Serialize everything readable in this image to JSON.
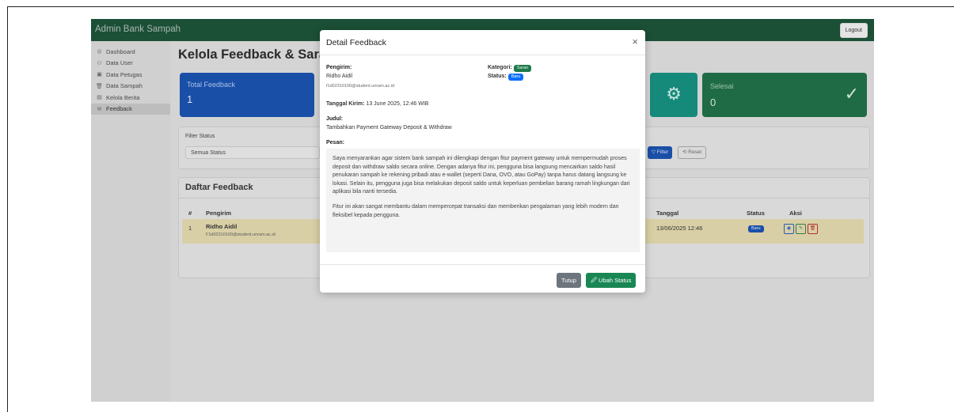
{
  "navbar": {
    "brand": "Admin Bank Sampah",
    "logout": "Logout"
  },
  "sidebar": {
    "items": [
      {
        "icon": "dashboard-icon",
        "glyph": "◎",
        "label": "Dashboard"
      },
      {
        "icon": "users-icon",
        "glyph": "⚇",
        "label": "Data User"
      },
      {
        "icon": "officer-icon",
        "glyph": "▣",
        "label": "Data Petugas"
      },
      {
        "icon": "trash-icon",
        "glyph": "🗑",
        "label": "Data Sampah"
      },
      {
        "icon": "news-icon",
        "glyph": "▤",
        "label": "Kelola Berita"
      },
      {
        "icon": "feedback-icon",
        "glyph": "✉",
        "label": "Feedback"
      }
    ]
  },
  "page": {
    "title": "Kelola Feedback & Saran"
  },
  "cards": {
    "total": {
      "label": "Total Feedback",
      "value": "1"
    },
    "selesai": {
      "label": "Selesai",
      "value": "0"
    }
  },
  "filter": {
    "label": "Filter Status",
    "selected": "Semua Status",
    "filter_btn": "▽ Filter",
    "reset_btn": "⟲ Reset"
  },
  "list": {
    "title": "Daftar Feedback",
    "headers": {
      "no": "#",
      "pengirim": "Pengirim",
      "tanggal": "Tanggal",
      "status": "Status",
      "aksi": "Aksi"
    },
    "rows": [
      {
        "no": "1",
        "name": "Ridho Aidil",
        "email": "F1d02310100@student.unram.ac.id",
        "tanggal": "13/06/2025 12:46",
        "status": "Baru"
      }
    ]
  },
  "modal": {
    "title": "Detail Feedback",
    "close": "×",
    "pengirim_label": "Pengirim:",
    "pengirim_name": "Ridho Aidil",
    "pengirim_email": "f1d02310100@student.unram.ac.id",
    "kategori_label": "Kategori:",
    "kategori_value": "Saran",
    "status_label": "Status:",
    "status_value": "Baru",
    "tanggal_label": "Tanggal Kirim:",
    "tanggal_value": "13 June 2025, 12:46 WIB",
    "judul_label": "Judul:",
    "judul_value": "Tambahkan Payment Gateway Deposit & Withdraw",
    "pesan_label": "Pesan:",
    "pesan_p1": "Saya menyarankan agar sistem bank sampah ini dilengkapi dengan fitur payment gateway untuk mempermudah proses deposit dan withdraw saldo secara online. Dengan adanya fitur ini, pengguna bisa langsung mencairkan saldo hasil penukaran sampah ke rekening pribadi atau e-wallet (seperti Dana, OVO, atau GoPay) tanpa harus datang langsung ke lokasi. Selain itu, pengguna juga bisa melakukan deposit saldo untuk keperluan pembelian barang ramah lingkungan dari aplikasi bila nanti tersedia.",
    "pesan_p2": "Fitur ini akan sangat membantu dalam mempercepat transaksi dan memberikan pengalaman yang lebih modern dan fleksibel kepada pengguna.",
    "btn_tutup": "Tutup",
    "btn_ubah": "🖉 Ubah Status"
  },
  "colors": {
    "navbar": "#1b4f36",
    "primary": "#1a4fa8",
    "success": "#198754",
    "secondary": "#6c757d"
  }
}
